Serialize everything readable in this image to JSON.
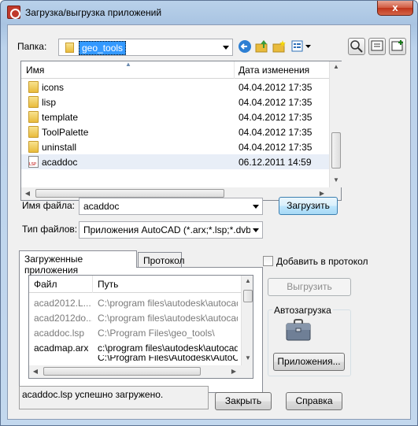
{
  "window": {
    "title": "Загрузка/выгрузка приложений",
    "close_glyph": "x"
  },
  "folder_bar": {
    "label": "Папка:",
    "value": "geo_tools"
  },
  "file_list": {
    "headers": {
      "name": "Имя",
      "date": "Дата изменения"
    },
    "rows": [
      {
        "name": "icons",
        "date": "04.04.2012 17:35",
        "icon": "folder-icon"
      },
      {
        "name": "lisp",
        "date": "04.04.2012 17:35",
        "icon": "folder-icon"
      },
      {
        "name": "template",
        "date": "04.04.2012 17:35",
        "icon": "folder-icon"
      },
      {
        "name": "ToolPalette",
        "date": "04.04.2012 17:35",
        "icon": "folder-icon"
      },
      {
        "name": "uninstall",
        "date": "04.04.2012 17:35",
        "icon": "folder-icon"
      },
      {
        "name": "acaddoc",
        "date": "06.12.2011 14:59",
        "icon": "lsp-file-icon"
      }
    ]
  },
  "filename": {
    "label": "Имя файла:",
    "value": "acaddoc"
  },
  "filetype": {
    "label": "Тип файлов:",
    "value": "Приложения AutoCAD (*.arx;*.lsp;*.dvb;*.db"
  },
  "buttons": {
    "load": "Загрузить",
    "unload": "Выгрузить",
    "applications": "Приложения...",
    "close": "Закрыть",
    "help": "Справка"
  },
  "tabs": {
    "loaded": "Загруженные приложения",
    "log": "Протокол"
  },
  "add_to_log": {
    "label": "Добавить в протокол",
    "checked": false
  },
  "app_list": {
    "headers": {
      "file": "Файл",
      "path": "Путь"
    },
    "rows": [
      {
        "file": "acad2012.L...",
        "path": "C:\\program files\\autodesk\\autocad ...",
        "grey": true
      },
      {
        "file": "acad2012do...",
        "path": "C:\\program files\\autodesk\\autocad ...",
        "grey": true
      },
      {
        "file": "acaddoc.lsp",
        "path": "C:\\Program Files\\geo_tools\\",
        "grey": true
      },
      {
        "file": "acadmap.arx",
        "path": "c:\\program files\\autodesk\\autocad ...",
        "grey": false
      },
      {
        "file": "",
        "path": "C:\\Program Files\\Autodesk\\AutoCA...",
        "grey": false
      }
    ]
  },
  "autoload": {
    "label": "Автозагрузка"
  },
  "status": {
    "message": "acaddoc.lsp успешно загружено."
  },
  "colors": {
    "title_bar": "#b9d1ea",
    "close_button": "#c0351b",
    "selection": "#3399ff",
    "default_button": "#a7d9f5"
  }
}
